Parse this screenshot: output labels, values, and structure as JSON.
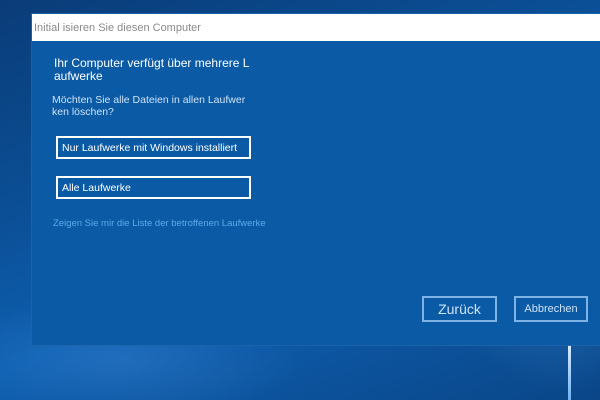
{
  "window": {
    "title": "Initial isieren Sie diesen Computer"
  },
  "content": {
    "heading": "Ihr Computer verfügt über mehrere L aufwerke",
    "question": "Möchten Sie alle Dateien in allen Laufwer ken löschen?",
    "options": [
      {
        "label": "Nur Laufwerke mit Windows installiert"
      },
      {
        "label": "Alle Laufwerke"
      }
    ],
    "link": "Zeigen Sie mir die Liste der betroffenen Laufwerke"
  },
  "buttons": {
    "back_label": "Zurück",
    "cancel_label": "Abbrechen"
  },
  "colors": {
    "dialog_background": "#0a5aa5",
    "link": "#5fa9ec",
    "titlebar": "#ffffff"
  }
}
